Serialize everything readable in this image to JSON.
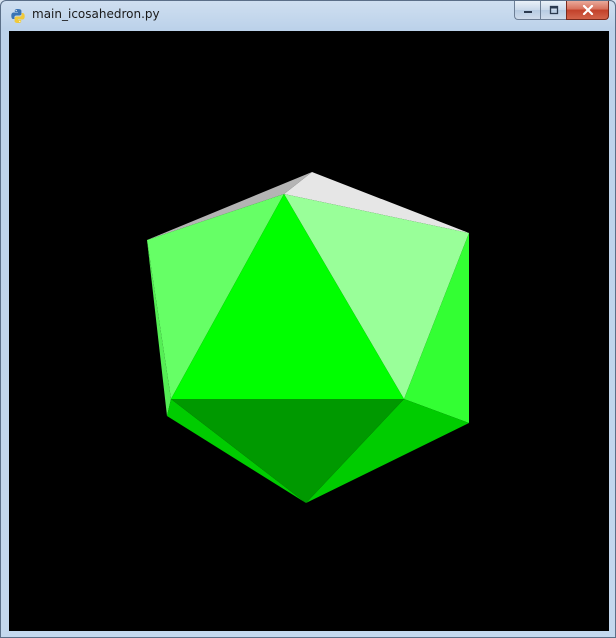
{
  "window": {
    "title": "main_icosahedron.py",
    "app_icon": "python-icon",
    "buttons": {
      "minimize_icon": "minimize-icon",
      "maximize_icon": "maximize-icon",
      "close_icon": "close-icon"
    }
  },
  "scene": {
    "object": "icosahedron",
    "background": "#000000",
    "colors": {
      "white_top": "#e6e6e6",
      "grey_left": "#b4b4b4",
      "light_green": "#99ff99",
      "mid_light_green": "#66ff66",
      "bright_green": "#00ff00",
      "medium_green": "#33ff33",
      "green": "#00cc00",
      "dark_green": "#009900",
      "side_green": "#00dd00"
    }
  }
}
